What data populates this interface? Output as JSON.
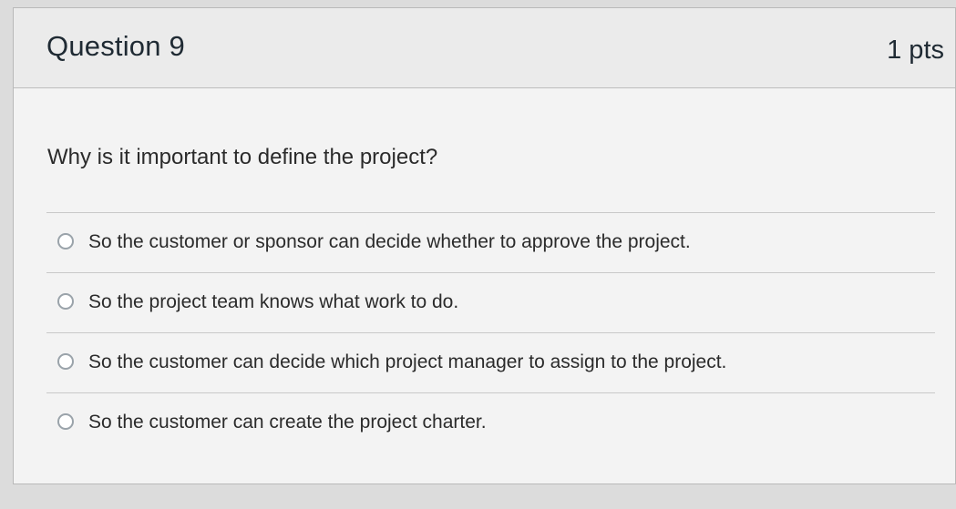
{
  "question": {
    "title": "Question 9",
    "points": "1 pts",
    "text": "Why is it important to define the project?",
    "answers": [
      {
        "label": "So the customer or sponsor can decide whether to approve the project.",
        "selected": false
      },
      {
        "label": "So the project team knows what work to do.",
        "selected": false
      },
      {
        "label": "So the customer can decide which project manager to assign to the project.",
        "selected": false
      },
      {
        "label": "So the customer can create the project charter.",
        "selected": false
      }
    ]
  }
}
